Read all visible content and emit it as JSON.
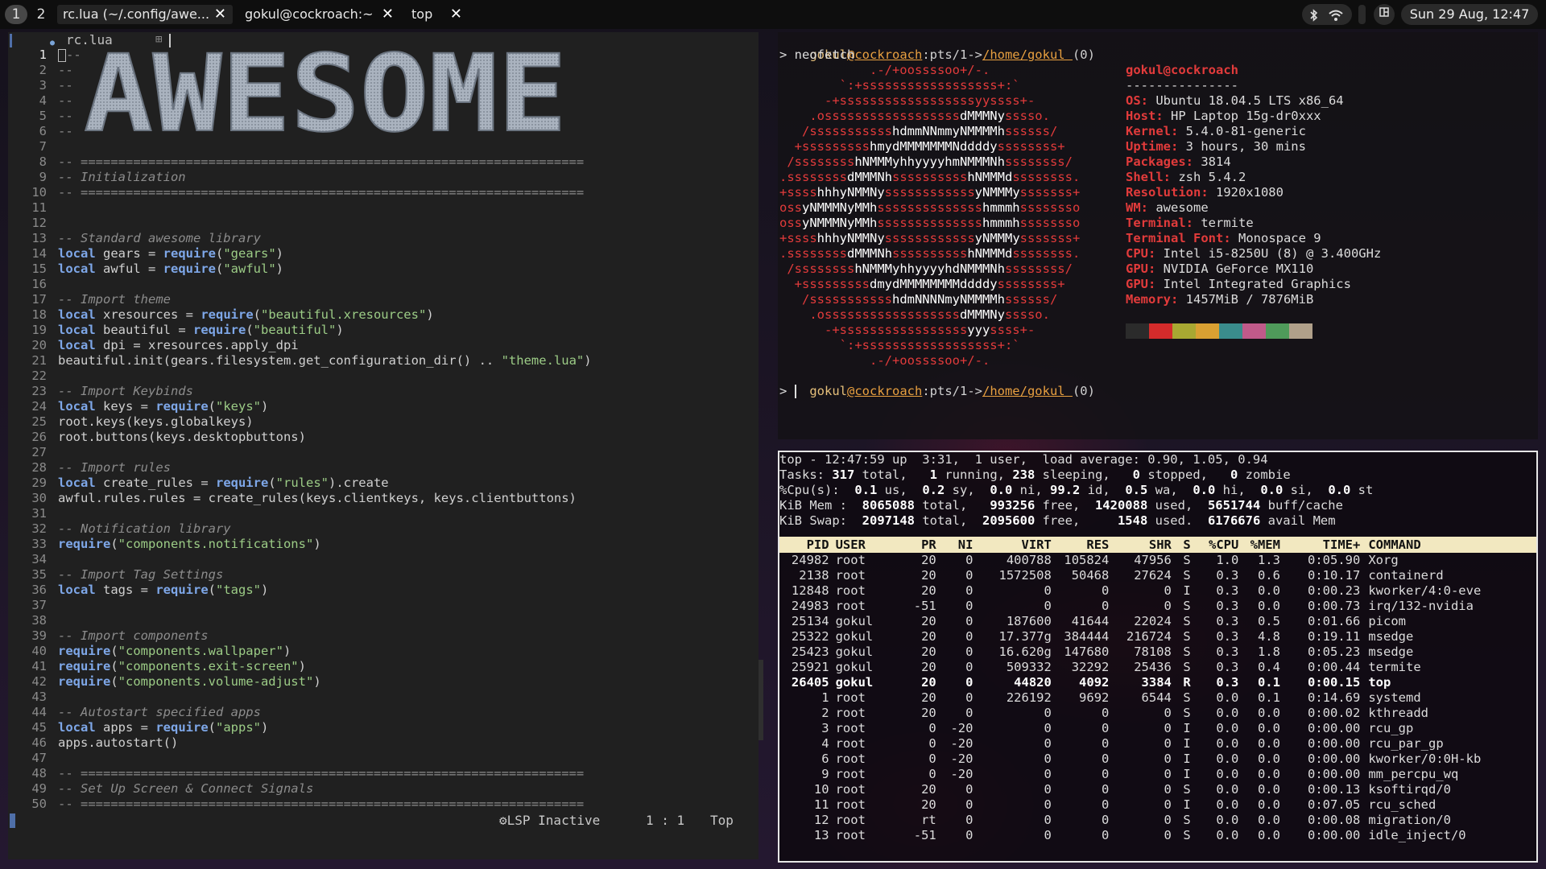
{
  "topbar": {
    "tags": [
      "1",
      "2"
    ],
    "tasks": [
      {
        "label": "rc.lua (~/.config/awe...",
        "close": "✕"
      },
      {
        "label": "gokul@cockroach:~",
        "close": "✕"
      },
      {
        "label": "top",
        "close": "✕"
      }
    ],
    "clock": "Sun 29 Aug, 12:47",
    "systray_icons": [
      "bluetooth-icon",
      "wifi-icon"
    ],
    "layout_icon": "layout-icon"
  },
  "editor": {
    "filename": "rc.lua",
    "banner_text": "AWESOME",
    "lines": [
      {
        "n": "1",
        "html": "<span class='curbox'></span><span class='cm'>--</span>"
      },
      {
        "n": "2",
        "html": "<span class='cm'>--</span>"
      },
      {
        "n": "3",
        "html": "<span class='cm'>--</span>"
      },
      {
        "n": "4",
        "html": "<span class='cm'>--</span>"
      },
      {
        "n": "5",
        "html": "<span class='cm'>--</span>"
      },
      {
        "n": "6",
        "html": "<span class='cm'>--</span>"
      },
      {
        "n": "7",
        "html": ""
      },
      {
        "n": "8",
        "html": "<span class='cm'>-- ===================================================================</span>"
      },
      {
        "n": "9",
        "html": "<span class='cmi'>-- Initialization</span>"
      },
      {
        "n": "10",
        "html": "<span class='cm'>-- ===================================================================</span>"
      },
      {
        "n": "11",
        "html": ""
      },
      {
        "n": "12",
        "html": ""
      },
      {
        "n": "13",
        "html": "<span class='cmi'>-- Standard awesome library</span>"
      },
      {
        "n": "14",
        "html": "<span class='kw'>local</span> gears = <span class='kw'>require</span>(<span class='st'>\"gears\"</span>)"
      },
      {
        "n": "15",
        "html": "<span class='kw'>local</span> awful = <span class='kw'>require</span>(<span class='st'>\"awful\"</span>)"
      },
      {
        "n": "16",
        "html": ""
      },
      {
        "n": "17",
        "html": "<span class='cmi'>-- Import theme</span>"
      },
      {
        "n": "18",
        "html": "<span class='kw'>local</span> xresources = <span class='kw'>require</span>(<span class='st'>\"beautiful.xresources\"</span>)"
      },
      {
        "n": "19",
        "html": "<span class='kw'>local</span> beautiful = <span class='kw'>require</span>(<span class='st'>\"beautiful\"</span>)"
      },
      {
        "n": "20",
        "html": "<span class='kw'>local</span> dpi = xresources.apply_dpi"
      },
      {
        "n": "21",
        "html": "beautiful.init(gears.filesystem.get_configuration_dir() .. <span class='st'>\"theme.lua\"</span>)"
      },
      {
        "n": "22",
        "html": ""
      },
      {
        "n": "23",
        "html": "<span class='cmi'>-- Import Keybinds</span>"
      },
      {
        "n": "24",
        "html": "<span class='kw'>local</span> keys = <span class='kw'>require</span>(<span class='st'>\"keys\"</span>)"
      },
      {
        "n": "25",
        "html": "root.keys(keys.globalkeys)"
      },
      {
        "n": "26",
        "html": "root.buttons(keys.desktopbuttons)"
      },
      {
        "n": "27",
        "html": ""
      },
      {
        "n": "28",
        "html": "<span class='cmi'>-- Import rules</span>"
      },
      {
        "n": "29",
        "html": "<span class='kw'>local</span> create_rules = <span class='kw'>require</span>(<span class='st'>\"rules\"</span>).create"
      },
      {
        "n": "30",
        "html": "awful.rules.rules = create_rules(keys.clientkeys, keys.clientbuttons)"
      },
      {
        "n": "31",
        "html": ""
      },
      {
        "n": "32",
        "html": "<span class='cmi'>-- Notification library</span>"
      },
      {
        "n": "33",
        "html": "<span class='kw'>require</span>(<span class='st'>\"components.notifications\"</span>)"
      },
      {
        "n": "34",
        "html": ""
      },
      {
        "n": "35",
        "html": "<span class='cmi'>-- Import Tag Settings</span>"
      },
      {
        "n": "36",
        "html": "<span class='kw'>local</span> tags = <span class='kw'>require</span>(<span class='st'>\"tags\"</span>)"
      },
      {
        "n": "37",
        "html": ""
      },
      {
        "n": "38",
        "html": ""
      },
      {
        "n": "39",
        "html": "<span class='cmi'>-- Import components</span>"
      },
      {
        "n": "40",
        "html": "<span class='kw'>require</span>(<span class='st'>\"components.wallpaper\"</span>)"
      },
      {
        "n": "41",
        "html": "<span class='kw'>require</span>(<span class='st'>\"components.exit-screen\"</span>)"
      },
      {
        "n": "42",
        "html": "<span class='kw'>require</span>(<span class='st'>\"components.volume-adjust\"</span>)"
      },
      {
        "n": "43",
        "html": ""
      },
      {
        "n": "44",
        "html": "<span class='cmi'>-- Autostart specified apps</span>"
      },
      {
        "n": "45",
        "html": "<span class='kw'>local</span> apps = <span class='kw'>require</span>(<span class='st'>\"apps\"</span>)"
      },
      {
        "n": "46",
        "html": "apps.autostart()"
      },
      {
        "n": "47",
        "html": ""
      },
      {
        "n": "48",
        "html": "<span class='cm'>-- ===================================================================</span>"
      },
      {
        "n": "49",
        "html": "<span class='cmi'>-- Set Up Screen &amp; Connect Signals</span>"
      },
      {
        "n": "50",
        "html": "<span class='cm'>-- ===================================================================</span>"
      }
    ],
    "status": {
      "lsp": "⚙LSP Inactive",
      "pos": "1 : 1",
      "pct": "Top"
    }
  },
  "neofetch": {
    "prompt_user": "gokul",
    "prompt_host": "@cockroach",
    "prompt_mid": ":pts/1->",
    "prompt_path": "/home/gokul ",
    "prompt_code": "(0)",
    "command": "> neofetch",
    "ascii": [
      "            .-/+oossssoo+/-.",
      "        `:+ssssssssssssssssss+:`",
      "      -+ssssssssssssssssssyyssss+-",
      "    .ossssssssssssssssssdMMMNysssso.",
      "   /ssssssssssshdmmNNmmyNMMMMhssssss/",
      "  +ssssssssshmydMMMMMMMNddddyssssssss+",
      " /sssssssshNMMMyhhyyyyhmNMMMNhssssssss/",
      ".ssssssssdMMMNhsssssssssshNMMMdssssssss.",
      "+sssshhhyNMMNyssssssssssssyNMMMysssssss+",
      "ossyNMMMNyMMhsssssssssssssshmmmhssssssso",
      "ossyNMMMNyMMhsssssssssssssshmmmhssssssso",
      "+sssshhhyNMMNyssssssssssssyNMMMysssssss+",
      ".ssssssssdMMMNhsssssssssshNMMMdssssssss.",
      " /sssssssshNMMMyhhyyyyhdNMMMNhssssssss/",
      "  +sssssssssdmydMMMMMMMMddddyssssssss+",
      "   /ssssssssssshdmNNNNmyNMMMMhssssss/",
      "    .ossssssssssssssssssdMMMNysssso.",
      "      -+sssssssssssssssssyyyssss+-",
      "        `:+ssssssssssssssssss+:`",
      "            .-/+oossssoo+/-."
    ],
    "title": "gokul@cockroach",
    "underline": "---------------",
    "info": [
      {
        "k": "OS",
        "v": "Ubuntu 18.04.5 LTS x86_64"
      },
      {
        "k": "Host",
        "v": "HP Laptop 15g-dr0xxx"
      },
      {
        "k": "Kernel",
        "v": "5.4.0-81-generic"
      },
      {
        "k": "Uptime",
        "v": "3 hours, 30 mins"
      },
      {
        "k": "Packages",
        "v": "3814"
      },
      {
        "k": "Shell",
        "v": "zsh 5.4.2"
      },
      {
        "k": "Resolution",
        "v": "1920x1080"
      },
      {
        "k": "WM",
        "v": "awesome"
      },
      {
        "k": "Terminal",
        "v": "termite"
      },
      {
        "k": "Terminal Font",
        "v": "Monospace 9"
      },
      {
        "k": "CPU",
        "v": "Intel i5-8250U (8) @ 3.400GHz"
      },
      {
        "k": "GPU",
        "v": "NVIDIA GeForce MX110"
      },
      {
        "k": "GPU",
        "v": "Intel Integrated Graphics"
      },
      {
        "k": "Memory",
        "v": "1457MiB / 7876MiB"
      }
    ],
    "swatches": [
      "#2b2b2b",
      "#d42b2b",
      "#a8a832",
      "#d9a032",
      "#3a8c8c",
      "#c05a8a",
      "#4f9a5a",
      "#b0a08a"
    ],
    "last_prompt": "> "
  },
  "top": {
    "summary": [
      "top - 12:47:59 up  3:31,  1 user,  load average: 0.90, 1.05, 0.94",
      "Tasks: <b>317</b> total,   <b>1</b> running, <b>238</b> sleeping,   <b>0</b> stopped,   <b>0</b> zombie",
      "%Cpu(s):  <b>0.1</b> us,  <b>0.2</b> sy,  <b>0.0</b> ni, <b>99.2</b> id,  <b>0.5</b> wa,  <b>0.0</b> hi,  <b>0.0</b> si,  <b>0.0</b> st",
      "KiB Mem :  <b>8065088</b> total,   <b>993256</b> free,  <b>1420088</b> used,  <b>5651744</b> buff/cache",
      "KiB Swap:  <b>2097148</b> total,  <b>2095600</b> free,     <b>1548</b> used.  <b>6176676</b> avail Mem"
    ],
    "columns": [
      "PID",
      "USER",
      "PR",
      "NI",
      "VIRT",
      "RES",
      "SHR",
      "S",
      "%CPU",
      "%MEM",
      "TIME+",
      "COMMAND"
    ],
    "rows": [
      [
        "24982",
        "root",
        "20",
        "0",
        "400788",
        "105824",
        "47956",
        "S",
        "1.0",
        "1.3",
        "0:05.90",
        "Xorg"
      ],
      [
        "2138",
        "root",
        "20",
        "0",
        "1572508",
        "50468",
        "27624",
        "S",
        "0.3",
        "0.6",
        "0:10.17",
        "containerd"
      ],
      [
        "12848",
        "root",
        "20",
        "0",
        "0",
        "0",
        "0",
        "I",
        "0.3",
        "0.0",
        "0:00.23",
        "kworker/4:0-eve"
      ],
      [
        "24983",
        "root",
        "-51",
        "0",
        "0",
        "0",
        "0",
        "S",
        "0.3",
        "0.0",
        "0:00.73",
        "irq/132-nvidia"
      ],
      [
        "25134",
        "gokul",
        "20",
        "0",
        "187600",
        "41644",
        "22024",
        "S",
        "0.3",
        "0.5",
        "0:01.66",
        "picom"
      ],
      [
        "25322",
        "gokul",
        "20",
        "0",
        "17.377g",
        "384444",
        "216724",
        "S",
        "0.3",
        "4.8",
        "0:19.11",
        "msedge"
      ],
      [
        "25423",
        "gokul",
        "20",
        "0",
        "16.620g",
        "147680",
        "78108",
        "S",
        "0.3",
        "1.8",
        "0:05.23",
        "msedge"
      ],
      [
        "25921",
        "gokul",
        "20",
        "0",
        "509332",
        "32292",
        "25436",
        "S",
        "0.3",
        "0.4",
        "0:00.44",
        "termite"
      ],
      [
        "26405",
        "gokul",
        "20",
        "0",
        "44820",
        "4092",
        "3384",
        "R",
        "0.3",
        "0.1",
        "0:00.15",
        "top"
      ],
      [
        "1",
        "root",
        "20",
        "0",
        "226192",
        "9692",
        "6544",
        "S",
        "0.0",
        "0.1",
        "0:14.69",
        "systemd"
      ],
      [
        "2",
        "root",
        "20",
        "0",
        "0",
        "0",
        "0",
        "S",
        "0.0",
        "0.0",
        "0:00.02",
        "kthreadd"
      ],
      [
        "3",
        "root",
        "0",
        "-20",
        "0",
        "0",
        "0",
        "I",
        "0.0",
        "0.0",
        "0:00.00",
        "rcu_gp"
      ],
      [
        "4",
        "root",
        "0",
        "-20",
        "0",
        "0",
        "0",
        "I",
        "0.0",
        "0.0",
        "0:00.00",
        "rcu_par_gp"
      ],
      [
        "6",
        "root",
        "0",
        "-20",
        "0",
        "0",
        "0",
        "I",
        "0.0",
        "0.0",
        "0:00.00",
        "kworker/0:0H-kb"
      ],
      [
        "9",
        "root",
        "0",
        "-20",
        "0",
        "0",
        "0",
        "I",
        "0.0",
        "0.0",
        "0:00.00",
        "mm_percpu_wq"
      ],
      [
        "10",
        "root",
        "20",
        "0",
        "0",
        "0",
        "0",
        "S",
        "0.0",
        "0.0",
        "0:00.13",
        "ksoftirqd/0"
      ],
      [
        "11",
        "root",
        "20",
        "0",
        "0",
        "0",
        "0",
        "I",
        "0.0",
        "0.0",
        "0:07.05",
        "rcu_sched"
      ],
      [
        "12",
        "root",
        "rt",
        "0",
        "0",
        "0",
        "0",
        "S",
        "0.0",
        "0.0",
        "0:00.08",
        "migration/0"
      ],
      [
        "13",
        "root",
        "-51",
        "0",
        "0",
        "0",
        "0",
        "S",
        "0.0",
        "0.0",
        "0:00.00",
        "idle_inject/0"
      ]
    ],
    "bold_row_index": 8
  }
}
